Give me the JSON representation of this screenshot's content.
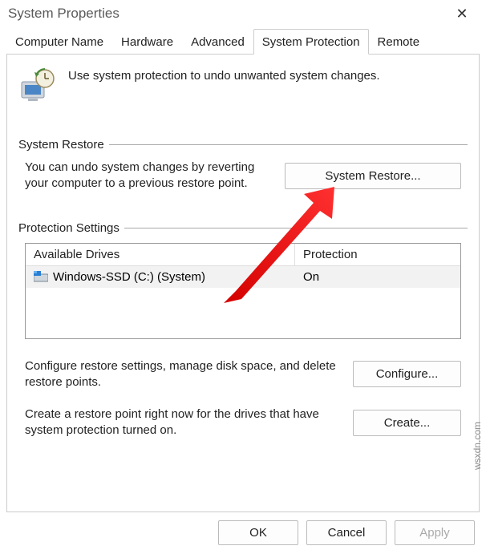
{
  "window": {
    "title": "System Properties"
  },
  "tabs": [
    {
      "label": "Computer Name"
    },
    {
      "label": "Hardware"
    },
    {
      "label": "Advanced"
    },
    {
      "label": "System Protection",
      "active": true
    },
    {
      "label": "Remote"
    }
  ],
  "intro": {
    "text": "Use system protection to undo unwanted system changes."
  },
  "restore": {
    "legend": "System Restore",
    "text": "You can undo system changes by reverting your computer to a previous restore point.",
    "button": "System Restore..."
  },
  "protection": {
    "legend": "Protection Settings",
    "headers": {
      "drives": "Available Drives",
      "protection": "Protection"
    },
    "rows": [
      {
        "drive": "Windows-SSD (C:) (System)",
        "protection": "On"
      }
    ],
    "configure": {
      "text": "Configure restore settings, manage disk space, and delete restore points.",
      "button": "Configure..."
    },
    "create": {
      "text": "Create a restore point right now for the drives that have system protection turned on.",
      "button": "Create..."
    }
  },
  "footer": {
    "ok": "OK",
    "cancel": "Cancel",
    "apply": "Apply"
  },
  "watermark": "wsxdn.com"
}
